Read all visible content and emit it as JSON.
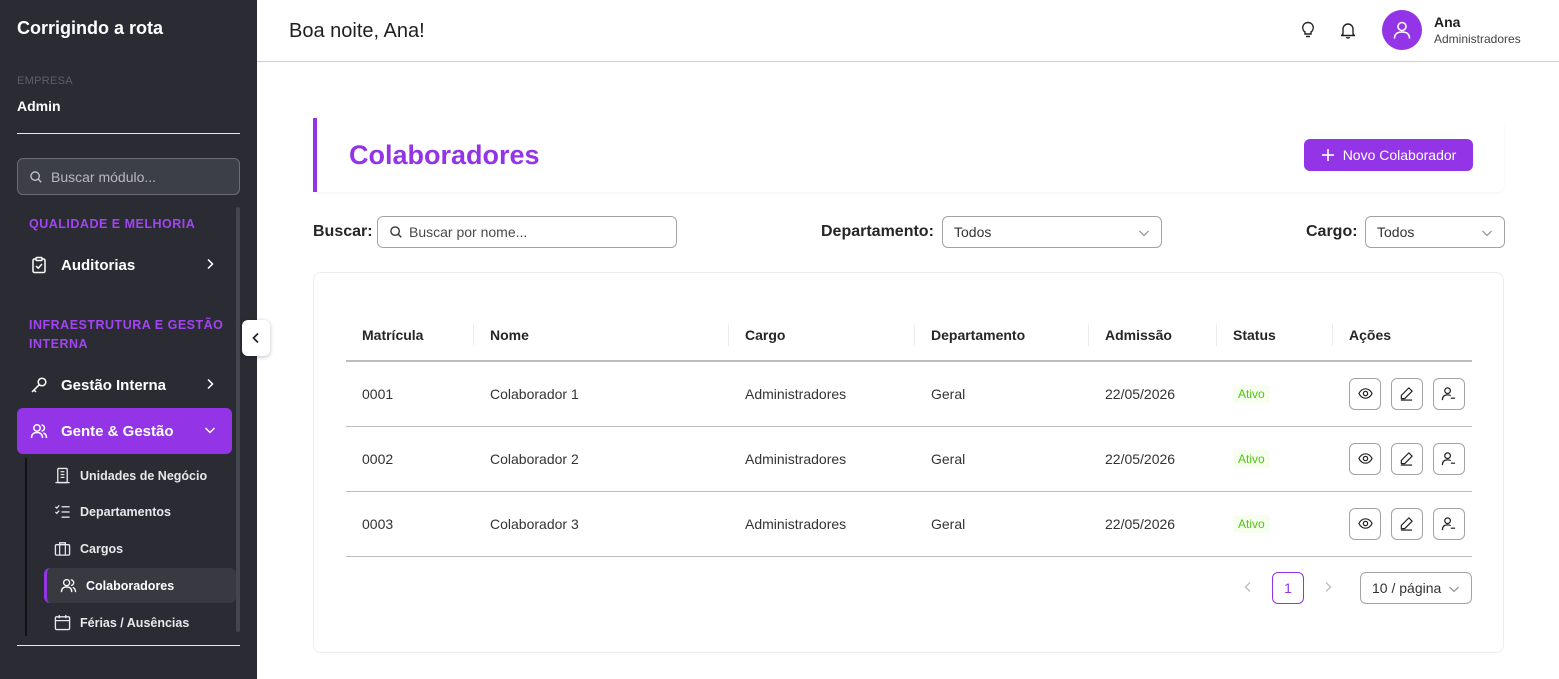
{
  "sidebar": {
    "brand": "Corrigindo a rota",
    "company_label": "EMPRESA",
    "company_name": "Admin",
    "search_placeholder": "Buscar módulo...",
    "groups": [
      {
        "title": "QUALIDADE E MELHORIA"
      },
      {
        "title": "INFRAESTRUTURA E GESTÃO INTERNA"
      }
    ],
    "items": [
      {
        "label": "Auditorias",
        "icon": "clipboard-check-icon"
      },
      {
        "label": "Gestão Interna",
        "icon": "key-icon"
      },
      {
        "label": "Gente & Gestão",
        "icon": "users-icon"
      }
    ],
    "subitems": [
      {
        "label": "Unidades de Negócio",
        "icon": "building-icon"
      },
      {
        "label": "Departamentos",
        "icon": "list-check-icon"
      },
      {
        "label": "Cargos",
        "icon": "briefcase-icon"
      },
      {
        "label": "Colaboradores",
        "icon": "users-icon"
      },
      {
        "label": "Férias / Ausências",
        "icon": "calendar-icon"
      }
    ]
  },
  "header": {
    "greeting": "Boa noite, Ana!",
    "user_name": "Ana",
    "user_role": "Administradores"
  },
  "page": {
    "title": "Colaboradores",
    "new_button": "Novo Colaborador"
  },
  "filters": {
    "search_label": "Buscar:",
    "search_placeholder": "Buscar por nome...",
    "department_label": "Departamento:",
    "department_value": "Todos",
    "role_label": "Cargo:",
    "role_value": "Todos"
  },
  "table": {
    "columns": [
      "Matrícula",
      "Nome",
      "Cargo",
      "Departamento",
      "Admissão",
      "Status",
      "Ações"
    ],
    "rows": [
      {
        "id": "0001",
        "name": "Colaborador 1",
        "role": "Administradores",
        "dept": "Geral",
        "admission": "22/05/2026",
        "status": "Ativo"
      },
      {
        "id": "0002",
        "name": "Colaborador 2",
        "role": "Administradores",
        "dept": "Geral",
        "admission": "22/05/2026",
        "status": "Ativo"
      },
      {
        "id": "0003",
        "name": "Colaborador 3",
        "role": "Administradores",
        "dept": "Geral",
        "admission": "22/05/2026",
        "status": "Ativo"
      }
    ]
  },
  "pagination": {
    "current_page": "1",
    "page_size": "10 / página"
  },
  "colors": {
    "accent": "#9334e6",
    "sidebar_bg": "#2b2c33",
    "status_active": "#52c41a"
  }
}
